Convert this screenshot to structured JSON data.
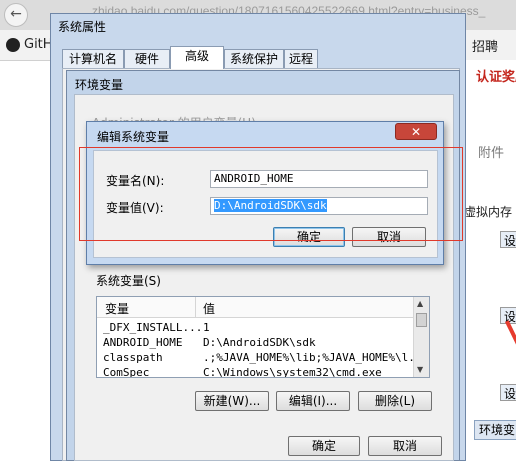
{
  "browser": {
    "back_glyph": "←",
    "url_fragment": "zhidao.baidu.com/question/1807161560425522669.html?entry=business_",
    "bookmark_github": "GitH",
    "bookmark_jobs": "招聘",
    "side_cert_text": "认证奖励",
    "side_attachments": "附件",
    "side_memory": "虚拟内存",
    "side_btn1": "设",
    "side_btn2": "设",
    "side_btn3": "设",
    "env_button": "环境变"
  },
  "system_properties": {
    "title": "系统属性",
    "tabs": [
      "计算机名",
      "硬件",
      "高级",
      "系统保护",
      "远程"
    ],
    "active_tab": "高级"
  },
  "env_vars": {
    "title": "环境变量",
    "user_vars_label_ghost": "Administrator 的用户变量(U)",
    "system_vars_label": "系统变量(S)",
    "columns": [
      "变量",
      "值"
    ],
    "rows": [
      {
        "name": "_DFX_INSTALL...",
        "value": "1"
      },
      {
        "name": "ANDROID_HOME",
        "value": "D:\\AndroidSDK\\sdk"
      },
      {
        "name": "classpath",
        "value": ".;%JAVA_HOME%\\lib;%JAVA_HOME%\\l..."
      },
      {
        "name": "ComSpec",
        "value": "C:\\Windows\\system32\\cmd.exe"
      }
    ],
    "new_button": "新建(W)...",
    "edit_button": "编辑(I)...",
    "delete_button": "删除(L)",
    "ok_button": "确定",
    "cancel_button": "取消"
  },
  "edit_dialog": {
    "title": "编辑系统变量",
    "close_glyph": "✕",
    "name_label": "变量名(N):",
    "name_value": "ANDROID_HOME",
    "value_label": "变量值(V):",
    "value_value": "D:\\AndroidSDK\\sdk",
    "ok_button": "确定",
    "cancel_button": "取消"
  },
  "colors": {
    "highlight_box": "#e0392b",
    "selection": "#3399ff",
    "dialog_frame": "#c6d9f1"
  }
}
